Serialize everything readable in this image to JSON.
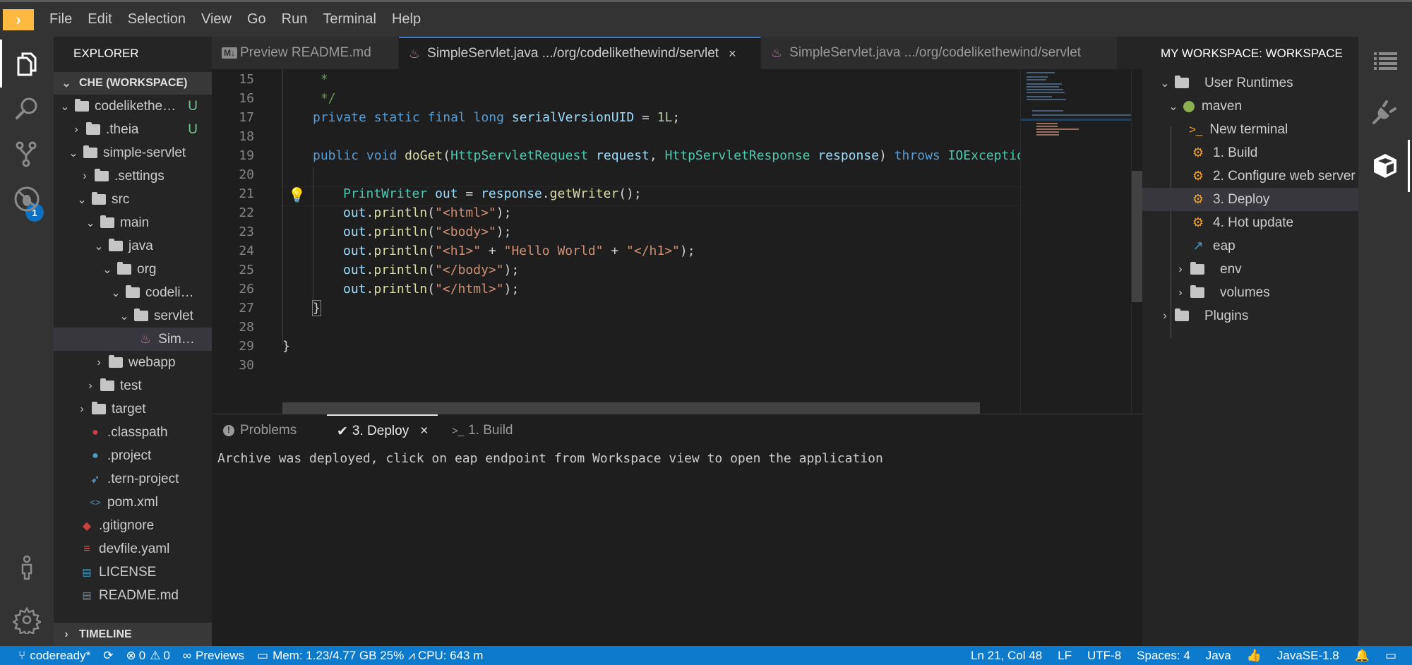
{
  "menubar": {
    "logo": "›",
    "items": [
      "File",
      "Edit",
      "Selection",
      "View",
      "Go",
      "Run",
      "Terminal",
      "Help"
    ]
  },
  "activity_bar": {
    "items": [
      "explorer-icon",
      "search-icon",
      "source-control-icon",
      "debug-icon"
    ],
    "source_control_badge": "1",
    "bottom": [
      "account-icon",
      "settings-gear-icon"
    ]
  },
  "explorer": {
    "title": "EXPLORER",
    "workspace": "CHE (WORKSPACE)",
    "tree": [
      {
        "label": "codelikethe…",
        "type": "folder",
        "expanded": true,
        "git": "U"
      },
      {
        "label": ".theia",
        "type": "folder",
        "expanded": false,
        "git": "U"
      },
      {
        "label": "simple-servlet",
        "type": "folder",
        "expanded": true
      },
      {
        "label": ".settings",
        "type": "folder",
        "expanded": false
      },
      {
        "label": "src",
        "type": "folder",
        "expanded": true
      },
      {
        "label": "main",
        "type": "folder",
        "expanded": true
      },
      {
        "label": "java",
        "type": "folder",
        "expanded": true
      },
      {
        "label": "org",
        "type": "folder",
        "expanded": true
      },
      {
        "label": "codeli…",
        "type": "folder",
        "expanded": true
      },
      {
        "label": "servlet",
        "type": "folder",
        "expanded": true
      },
      {
        "label": "Sim…",
        "type": "java-file",
        "selected": true
      },
      {
        "label": "webapp",
        "type": "folder",
        "expanded": false
      },
      {
        "label": "test",
        "type": "folder",
        "expanded": false
      },
      {
        "label": "target",
        "type": "folder",
        "expanded": false
      },
      {
        "label": ".classpath",
        "type": "classpath-file"
      },
      {
        "label": ".project",
        "type": "project-file"
      },
      {
        "label": ".tern-project",
        "type": "tern-file"
      },
      {
        "label": "pom.xml",
        "type": "xml-file"
      },
      {
        "label": ".gitignore",
        "type": "git-file"
      },
      {
        "label": "devfile.yaml",
        "type": "yaml-file"
      },
      {
        "label": "LICENSE",
        "type": "book-file"
      },
      {
        "label": "README.md",
        "type": "book-file"
      }
    ],
    "timeline": "TIMELINE"
  },
  "tabs": [
    {
      "icon": "M↓",
      "label": "Preview README.md",
      "active": false
    },
    {
      "icon": "java",
      "label": "SimpleServlet.java",
      "path": ".../org/codelikethewind/servlet",
      "active": true,
      "close": "×"
    },
    {
      "icon": "java",
      "label": "SimpleServlet.java",
      "path": ".../org/codelikethewind/servlet",
      "active": false
    }
  ],
  "editor": {
    "lines": [
      {
        "n": "15"
      },
      {
        "n": "16"
      },
      {
        "n": "17"
      },
      {
        "n": "18"
      },
      {
        "n": "19"
      },
      {
        "n": "20"
      },
      {
        "n": "21"
      },
      {
        "n": "22"
      },
      {
        "n": "23"
      },
      {
        "n": "24"
      },
      {
        "n": "25"
      },
      {
        "n": "26"
      },
      {
        "n": "27"
      },
      {
        "n": "28"
      },
      {
        "n": "29"
      },
      {
        "n": "30"
      }
    ],
    "code": {
      "l15": " *",
      "l16": " */",
      "l17": [
        "private",
        "static",
        "final",
        "long",
        "serialVersionUID",
        " = ",
        "1L",
        ";"
      ],
      "l19": [
        "public",
        "void",
        "doGet",
        "(",
        "HttpServletRequest",
        "request",
        ", ",
        "HttpServletResponse",
        "response",
        ") ",
        "throws",
        "IOExceptio"
      ],
      "l21": [
        "PrintWriter",
        "out",
        " = ",
        "response",
        ".",
        "getWriter",
        "();"
      ],
      "println_lines": [
        [
          "\"<html>\""
        ],
        [
          "\"<body>\""
        ],
        [
          "\"<h1>\"",
          " + ",
          "\"Hello World\"",
          " + ",
          "\"</h1>\""
        ],
        [
          "\"</body>\""
        ],
        [
          "\"</html>\""
        ]
      ],
      "out": "out",
      "println": "println",
      "l27": "}",
      "l29": "}"
    }
  },
  "panel": {
    "tabs": [
      {
        "icon": "!",
        "label": "Problems",
        "active": false
      },
      {
        "icon": "✔",
        "label": "3. Deploy",
        "active": true,
        "close": "×"
      },
      {
        "icon": ">_",
        "label": "1. Build",
        "active": false
      }
    ],
    "output": "Archive was deployed, click on eap endpoint from Workspace view to open the application"
  },
  "workspace_panel": {
    "title": "MY WORKSPACE: WORKSPACE",
    "tree": [
      {
        "label": "User Runtimes",
        "type": "folder",
        "expanded": true
      },
      {
        "label": "maven",
        "type": "runtime",
        "status_color": "#8bb04f",
        "expanded": true
      },
      {
        "label": "New terminal",
        "type": "terminal"
      },
      {
        "label": "1. Build",
        "type": "command"
      },
      {
        "label": "2. Configure web server",
        "type": "command"
      },
      {
        "label": "3. Deploy",
        "type": "command",
        "selected": true
      },
      {
        "label": "4. Hot update",
        "type": "command"
      },
      {
        "label": "eap",
        "type": "endpoint"
      },
      {
        "label": "env",
        "type": "folder",
        "expanded": false
      },
      {
        "label": "volumes",
        "type": "folder",
        "expanded": false
      },
      {
        "label": "Plugins",
        "type": "folder",
        "expanded": false
      }
    ]
  },
  "right_activity": [
    "outline-icon",
    "plugin-icon",
    "workspace-cube-icon"
  ],
  "statusbar": {
    "branch": "codeready*",
    "errors": "0",
    "warnings": "0",
    "previews": "Previews",
    "mem": "Mem: 1.23/4.77 GB 25%",
    "cpu": "CPU: 643 m",
    "position": "Ln 21, Col 48",
    "eol": "LF",
    "encoding": "UTF-8",
    "indent": "Spaces: 4",
    "language": "Java",
    "runtime": "JavaSE-1.8"
  },
  "colors": {
    "accent": "#0d7acc",
    "logo": "#fdb940",
    "git_untracked": "#73c991",
    "task_gear": "#f0a030"
  }
}
